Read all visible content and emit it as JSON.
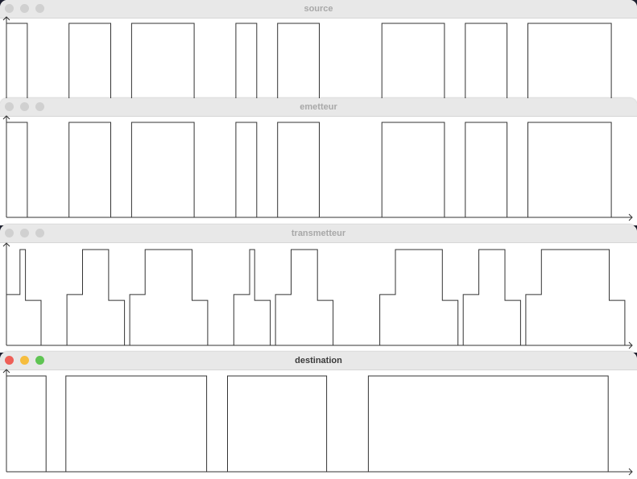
{
  "windows": [
    {
      "id": "source",
      "title": "source",
      "active": false
    },
    {
      "id": "emetteur",
      "title": "emetteur",
      "active": false
    },
    {
      "id": "transmetteur",
      "title": "transmetteur",
      "active": false
    },
    {
      "id": "destination",
      "title": "destination",
      "active": true
    }
  ],
  "colors": {
    "close": "#ee5f57",
    "minimize": "#f6bd3e",
    "zoom": "#5fc453",
    "inactive_light": "#d0d0d0",
    "trace": "#333333"
  },
  "chart_data": [
    {
      "type": "line",
      "name": "source",
      "x_range": [
        0,
        30
      ],
      "y_range": [
        0,
        1
      ],
      "bits": [
        1,
        0,
        0,
        1,
        1,
        0,
        1,
        1,
        1,
        0,
        0,
        1,
        0,
        1,
        1,
        0,
        0,
        0,
        1,
        1,
        1,
        0,
        1,
        1,
        0,
        1,
        1,
        1,
        1,
        0
      ]
    },
    {
      "type": "line",
      "name": "emetteur",
      "x_range": [
        0,
        30
      ],
      "y_range": [
        0,
        1
      ],
      "bits": [
        1,
        0,
        0,
        1,
        1,
        0,
        1,
        1,
        1,
        0,
        0,
        1,
        0,
        1,
        1,
        0,
        0,
        0,
        1,
        1,
        1,
        0,
        1,
        1,
        0,
        1,
        1,
        1,
        1,
        0
      ]
    },
    {
      "type": "line",
      "name": "transmetteur",
      "x_range": [
        0,
        30
      ],
      "y_range": [
        0,
        1
      ],
      "paths": [
        {
          "gain": 0.53,
          "delay": -0.1
        },
        {
          "gain": 0.47,
          "delay": 0.65
        }
      ]
    },
    {
      "type": "line",
      "name": "destination",
      "x_range": [
        0,
        30
      ],
      "y_range": [
        0,
        1
      ],
      "pulses": [
        [
          0,
          1.9
        ],
        [
          2.85,
          9.6
        ],
        [
          10.6,
          15.35
        ],
        [
          17.35,
          28.85
        ]
      ]
    }
  ]
}
